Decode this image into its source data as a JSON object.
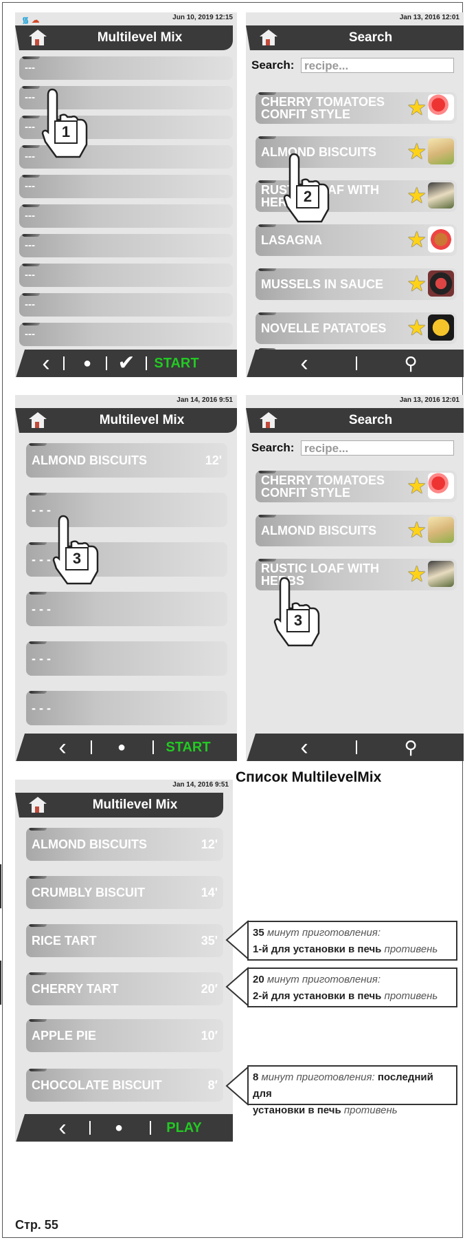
{
  "screens": {
    "s1": {
      "date": "Jun 10, 2019 12:15",
      "title": "Multilevel Mix",
      "rows": [
        "---",
        "---",
        "---",
        "---",
        "---",
        "---",
        "---",
        "---",
        "---",
        "---"
      ],
      "footer_start": "START",
      "step": "1"
    },
    "s2": {
      "date": "Jan 13, 2016 12:01",
      "title": "Search",
      "search_label": "Search:",
      "search_placeholder": "recipe...",
      "recipes": [
        {
          "line1": "CHERRY TOMATOES",
          "line2": "CONFIT STYLE"
        },
        {
          "line1": "ALMOND BISCUITS",
          "line2": ""
        },
        {
          "line1": "RUSTIC LOAF WITH",
          "line2": "HERBS"
        },
        {
          "line1": "LASAGNA",
          "line2": ""
        },
        {
          "line1": "MUSSELS IN SAUCE",
          "line2": ""
        },
        {
          "line1": "NOVELLE PATATOES",
          "line2": ""
        }
      ],
      "step": "2"
    },
    "s3": {
      "date": "Jan 14, 2016 9:51",
      "title": "Multilevel Mix",
      "rows": [
        {
          "name": "ALMOND BISCUITS",
          "time": "12'"
        },
        {
          "name": "- - -",
          "time": ""
        },
        {
          "name": "- - -",
          "time": ""
        },
        {
          "name": "- - -",
          "time": ""
        },
        {
          "name": "- - -",
          "time": ""
        },
        {
          "name": "- - -",
          "time": ""
        }
      ],
      "footer_start": "START",
      "step": "3"
    },
    "s4": {
      "date": "Jan 13, 2016 12:01",
      "title": "Search",
      "search_label": "Search:",
      "search_placeholder": "recipe...",
      "recipes": [
        {
          "line1": "CHERRY TOMATOES",
          "line2": "CONFIT STYLE"
        },
        {
          "line1": "ALMOND BISCUITS",
          "line2": ""
        },
        {
          "line1": "RUSTIC LOAF WITH",
          "line2": "HERBS"
        }
      ],
      "step": "3"
    },
    "s5": {
      "date": "Jan 14, 2016 9:51",
      "title": "Multilevel Mix",
      "rows": [
        {
          "name": "ALMOND BISCUITS",
          "time": "12'"
        },
        {
          "name": "CRUMBLY BISCUIT",
          "time": "14'"
        },
        {
          "name": "RICE TART",
          "time": "35'"
        },
        {
          "name": "CHERRY TART",
          "time": "20′"
        },
        {
          "name": "APPLE PIE",
          "time": "10′"
        },
        {
          "name": "CHOCOLATE BISCUIT",
          "time": "8′"
        }
      ],
      "footer_play": "PLAY"
    }
  },
  "list_title": "Список MultilevelMix",
  "callouts": [
    {
      "num": "35",
      "text1": " минут приготовления:",
      "line2_bold": "1-й для установки в печь",
      "line2_ital": " противень"
    },
    {
      "num": "20",
      "text1": " минут приготовления:",
      "line2_bold": "2-й для установки в печь",
      "line2_ital": " противень"
    },
    {
      "num": "8",
      "text1": " минут приготовления: ",
      "text1_bold": "последний для",
      "line2_bold": "установки в печь",
      "line2_ital": " противень"
    }
  ],
  "page_number": "Стр. 55",
  "colors": {
    "header": "#3a3a3a",
    "start_green": "#23c923",
    "star_yellow": "#ffd21a",
    "screen_bg": "#e6e6e6"
  }
}
